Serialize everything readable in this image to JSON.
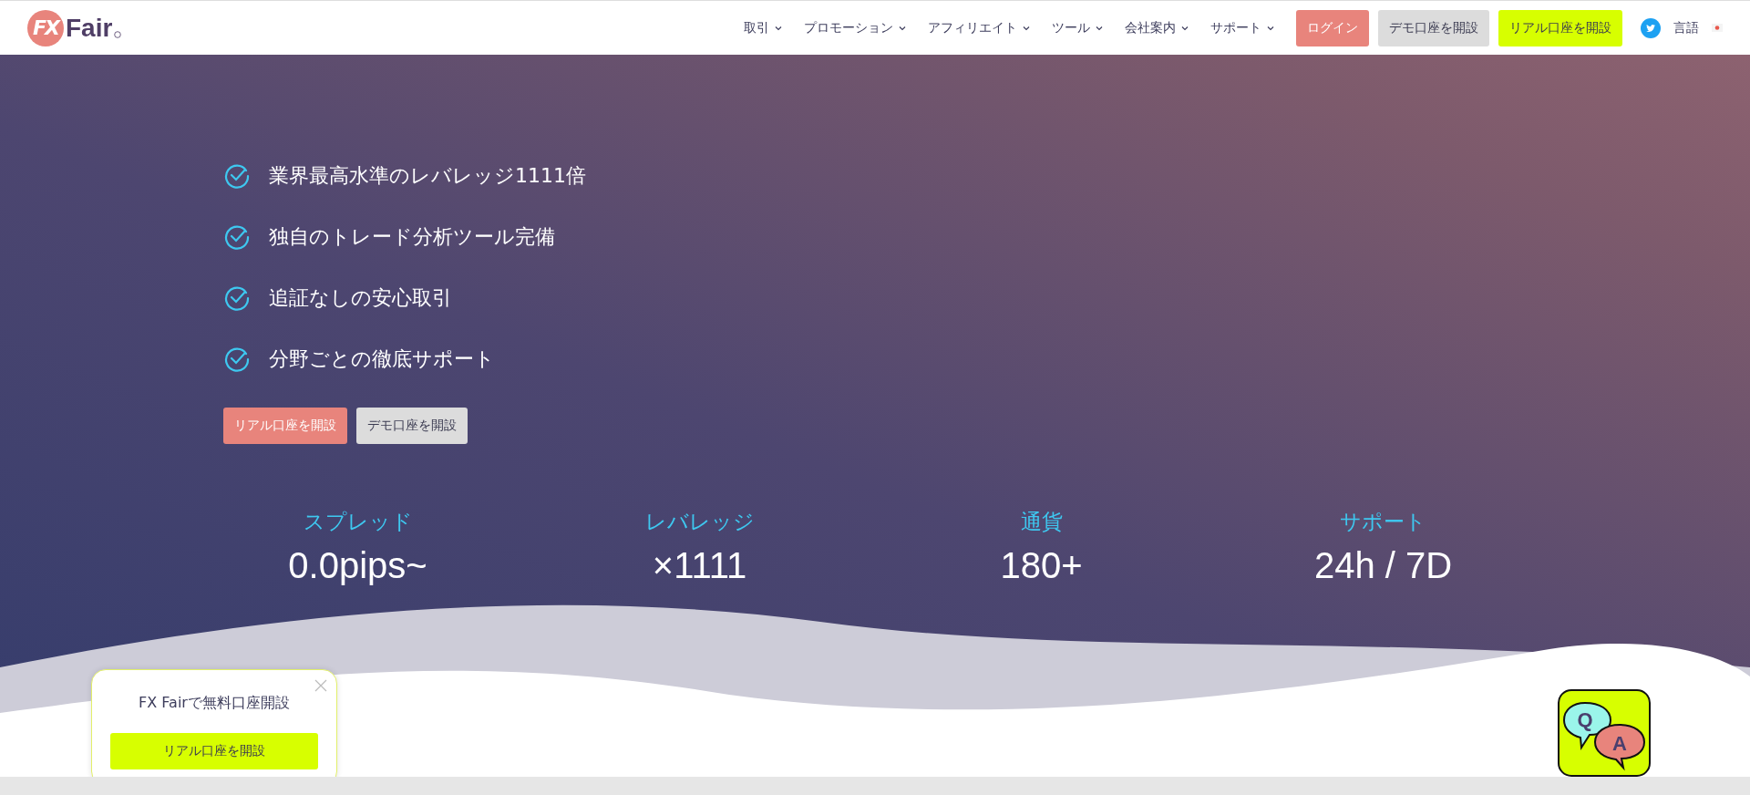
{
  "header": {
    "logo": {
      "mark": "FX",
      "name": "Fair"
    },
    "nav": [
      {
        "label": "取引"
      },
      {
        "label": "プロモーション"
      },
      {
        "label": "アフィリエイト"
      },
      {
        "label": "ツール"
      },
      {
        "label": "会社案内"
      },
      {
        "label": "サポート"
      }
    ],
    "buttons": [
      {
        "kind": "login",
        "label": "ログイン"
      },
      {
        "kind": "demo",
        "label": "デモ口座を開設"
      },
      {
        "kind": "real",
        "label": "リアル口座を開設"
      }
    ],
    "language": "言語"
  },
  "hero": {
    "features": [
      "業界最高水準のレバレッジ1111倍",
      "独自のトレード分析ツール完備",
      "追証なしの安心取引",
      "分野ごとの徹底サポート"
    ],
    "buttons": [
      {
        "kind": "real",
        "label": "リアル口座を開設"
      },
      {
        "kind": "demo",
        "label": "デモ口座を開設"
      }
    ],
    "stats": [
      {
        "label": "スプレッド",
        "value": "0.0pips~"
      },
      {
        "label": "レバレッジ",
        "value": "×1111"
      },
      {
        "label": "通貨",
        "value": "180+"
      },
      {
        "label": "サポート",
        "value": "24h / 7D"
      }
    ]
  },
  "popup": {
    "title": "FX Fairで無料口座開設",
    "button": "リアル口座を開設"
  },
  "qa_widget": {
    "question": "Q",
    "answer": "A"
  }
}
